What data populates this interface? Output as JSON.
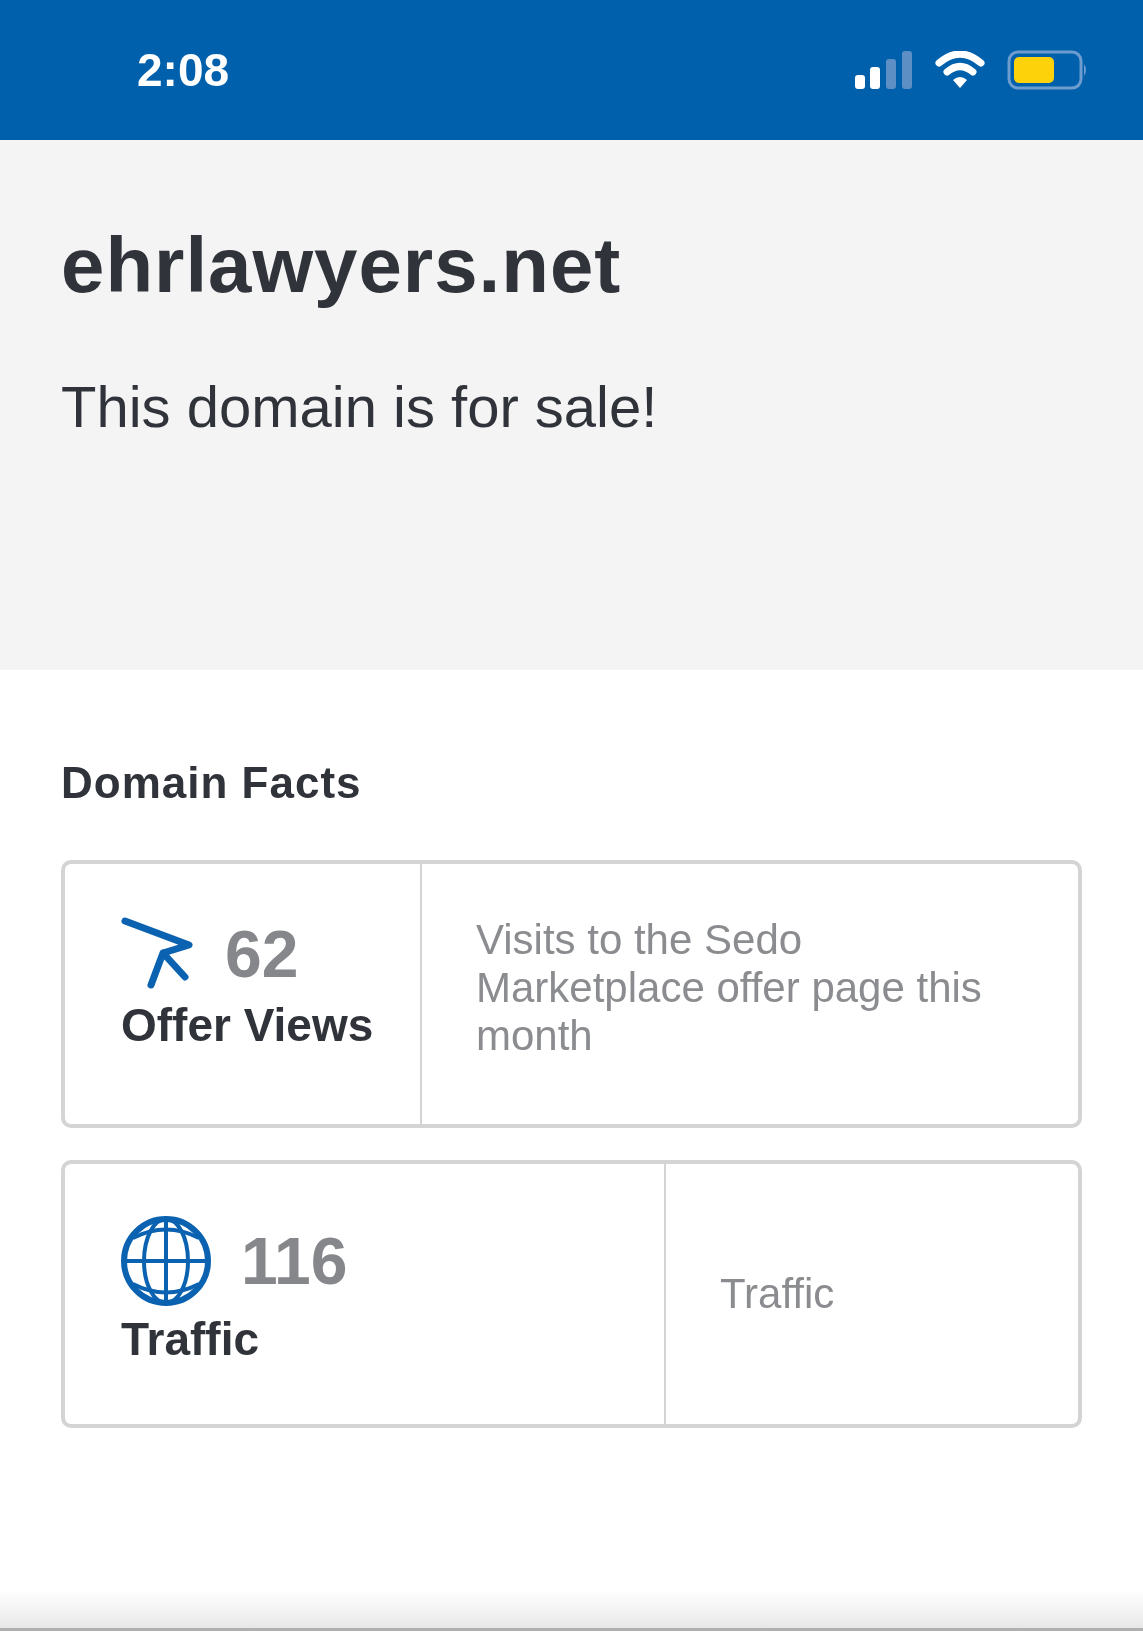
{
  "status_bar": {
    "time": "2:08"
  },
  "hero": {
    "domain": "ehrlawyers.net",
    "tagline": "This domain is for sale!"
  },
  "facts": {
    "heading": "Domain Facts",
    "cards": [
      {
        "value": "62",
        "label": "Offer Views",
        "description": "Visits to the Sedo Marketplace offer page this month"
      },
      {
        "value": "116",
        "label": "Traffic",
        "description": "Traffic"
      }
    ]
  }
}
